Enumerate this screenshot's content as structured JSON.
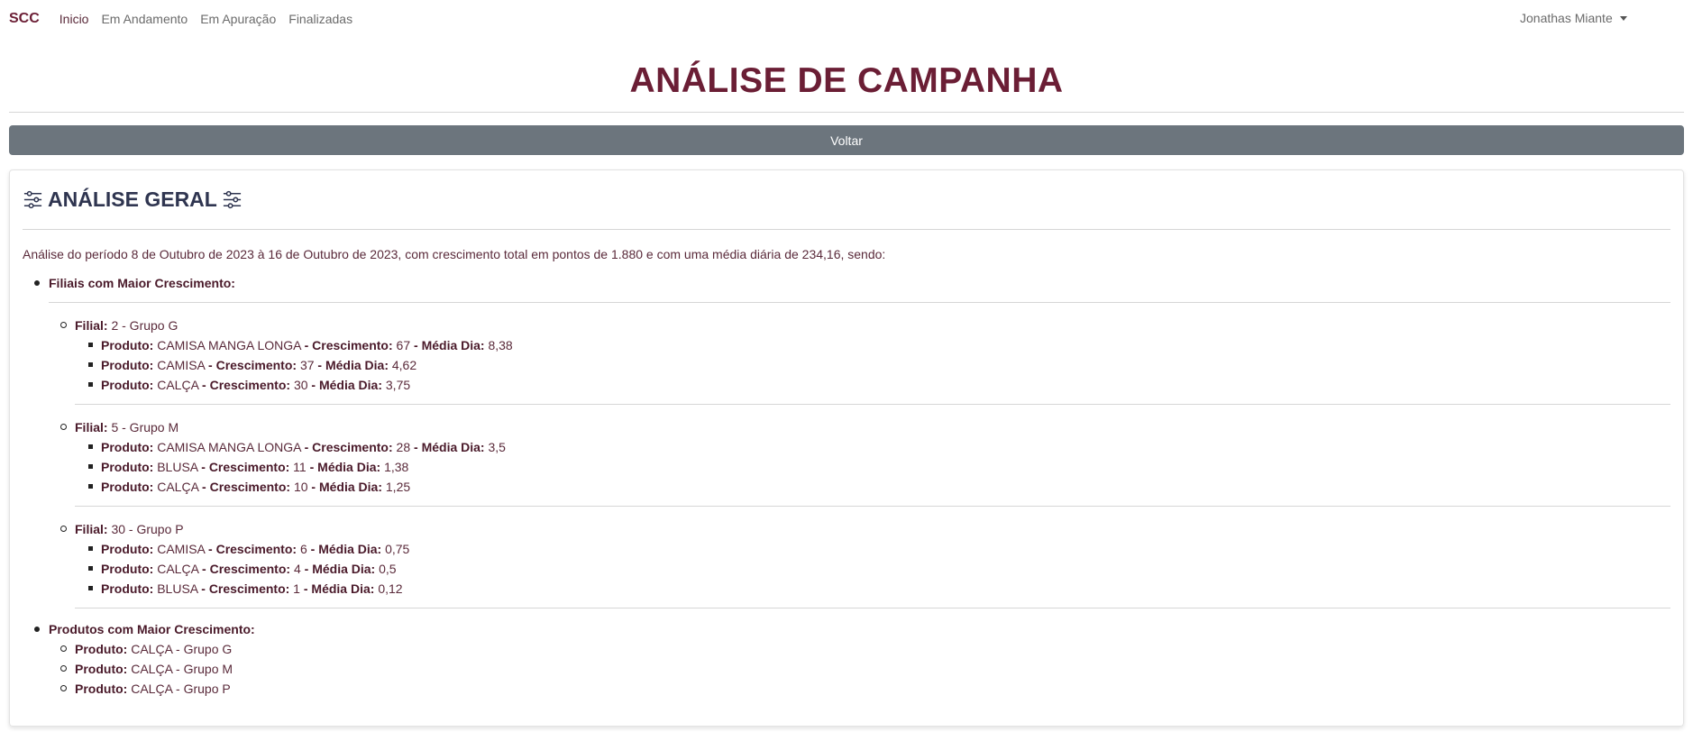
{
  "navbar": {
    "brand": "SCC",
    "links": [
      "Inicio",
      "Em Andamento",
      "Em Apuração",
      "Finalizadas"
    ],
    "user": "Jonathas Miante"
  },
  "page": {
    "title": "ANÁLISE DE CAMPANHA",
    "back_label": "Voltar"
  },
  "card": {
    "title": "ANÁLISE GERAL",
    "summary": "Análise do período 8 de Outubro de 2023 à 16 de Outubro de 2023, com crescimento total em pontos de 1.880 e com uma média diária de 234,16, sendo:",
    "section1_label": "Filiais com Maior Crescimento:",
    "section2_label": "Produtos com Maior Crescimento:",
    "filial_label": "Filial:",
    "produto_label": "Produto:",
    "crescimento_label": "Crescimento:",
    "media_label": "Média Dia:",
    "filiais": [
      {
        "name": "2 - Grupo G",
        "products": [
          {
            "name": "CAMISA MANGA LONGA",
            "growth": "67",
            "avg": "8,38"
          },
          {
            "name": "CAMISA",
            "growth": "37",
            "avg": "4,62"
          },
          {
            "name": "CALÇA",
            "growth": "30",
            "avg": "3,75"
          }
        ]
      },
      {
        "name": "5 - Grupo M",
        "products": [
          {
            "name": "CAMISA MANGA LONGA",
            "growth": "28",
            "avg": "3,5"
          },
          {
            "name": "BLUSA",
            "growth": "11",
            "avg": "1,38"
          },
          {
            "name": "CALÇA",
            "growth": "10",
            "avg": "1,25"
          }
        ]
      },
      {
        "name": "30 - Grupo P",
        "products": [
          {
            "name": "CAMISA",
            "growth": "6",
            "avg": "0,75"
          },
          {
            "name": "CALÇA",
            "growth": "4",
            "avg": "0,5"
          },
          {
            "name": "BLUSA",
            "growth": "1",
            "avg": "0,12"
          }
        ]
      }
    ],
    "top_products": [
      "CALÇA - Grupo G",
      "CALÇA - Grupo M",
      "CALÇA - Grupo P"
    ]
  }
}
